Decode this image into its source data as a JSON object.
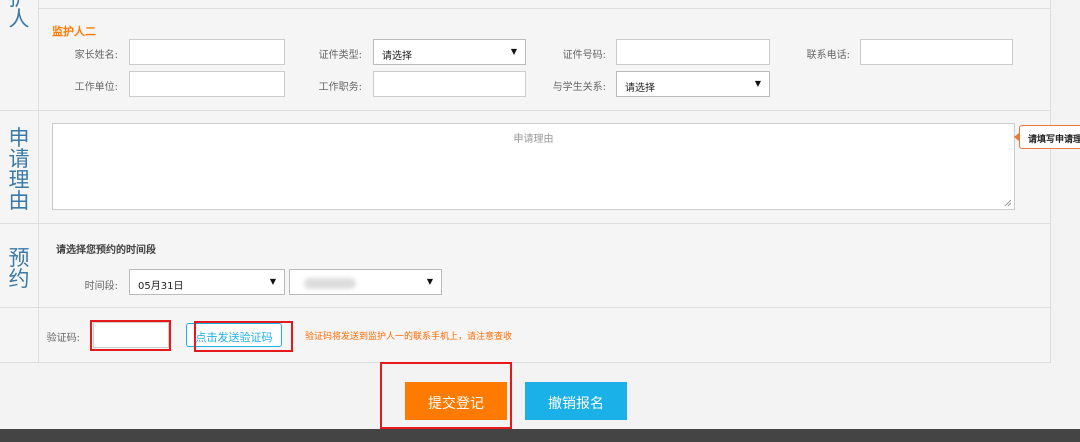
{
  "guardian2": {
    "side_label_top": "人",
    "section_title": "监护人二",
    "labels": {
      "name": "家长姓名:",
      "id_type": "证件类型:",
      "id_number": "证件号码:",
      "phone": "联系电话:",
      "work_unit": "工作单位:",
      "position": "工作职务:",
      "relation": "与学生关系:"
    },
    "id_type_value": "请选择",
    "relation_value": "请选择"
  },
  "reason": {
    "side_label": [
      "申",
      "请",
      "理",
      "由"
    ],
    "placeholder": "申请理由",
    "tooltip": "请填写申请理由"
  },
  "reservation": {
    "side_label": [
      "预",
      "约"
    ],
    "title": "请选择您预约的时间段",
    "time_label": "时间段:",
    "date_value": "05月31日"
  },
  "verify": {
    "label": "验证码:",
    "send_button": "点击发送验证码",
    "hint": "验证码将发送到监护人一的联系手机上，请注意查收"
  },
  "actions": {
    "submit": "提交登记",
    "cancel": "撤销报名"
  },
  "colors": {
    "orange": "#ff7a00",
    "cyan": "#1ab0e8",
    "red": "#e5191b",
    "side_text": "#3a79a8"
  }
}
